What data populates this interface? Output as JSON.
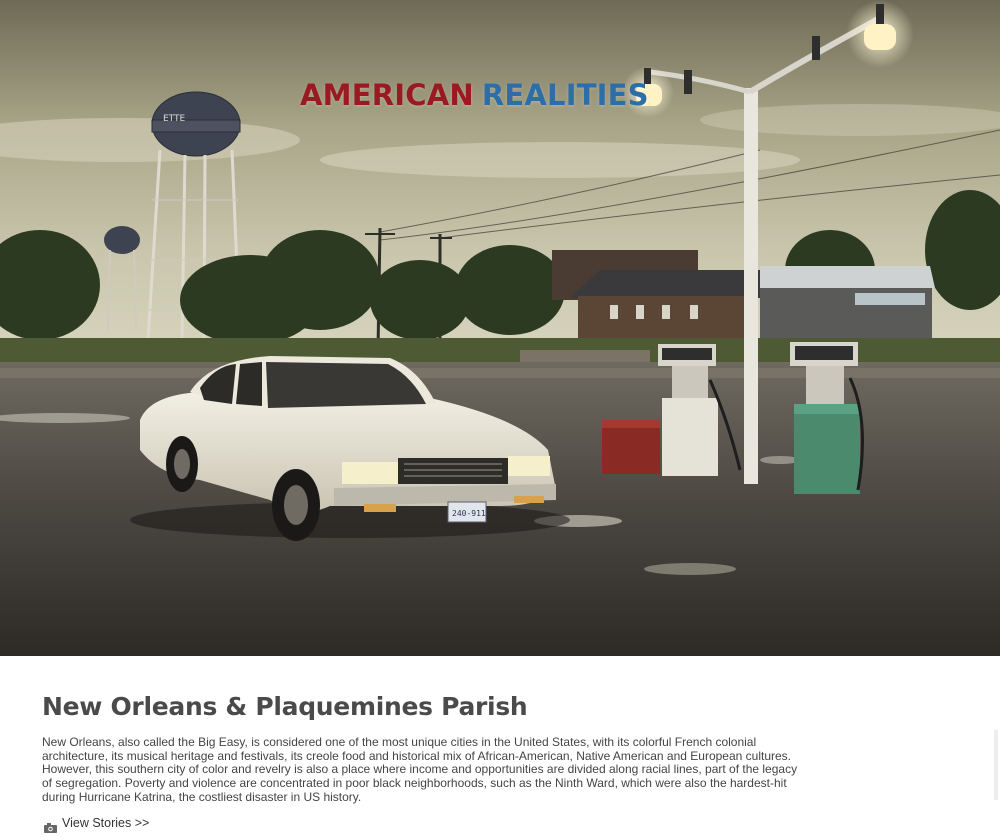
{
  "header": {
    "brand_word_1": "AMERICAN",
    "brand_word_2": "REALITIES",
    "brand_color_1": "#9a1a22",
    "brand_color_2": "#2e6ea8"
  },
  "hero": {
    "license_plate": "240-911"
  },
  "article": {
    "title": "New Orleans & Plaquemines Parish",
    "description": "New Orleans, also called the Big Easy, is considered one of the most unique cities in the United States, with its colorful French colonial architecture, its musical heritage and festivals, its creole food and historical mix of African-American, Native American and European cultures. However, this southern city of color and revelry is also a place where income and opportunities are divided along racial lines, part of the legacy of segregation. Poverty and violence are concentrated in poor black neighborhoods, such as the Ninth Ward, which were also the hardest-hit during Hurricane Katrina, the costliest disaster in US history.",
    "view_label": "View Stories >>",
    "view_icon": "camera-icon"
  }
}
